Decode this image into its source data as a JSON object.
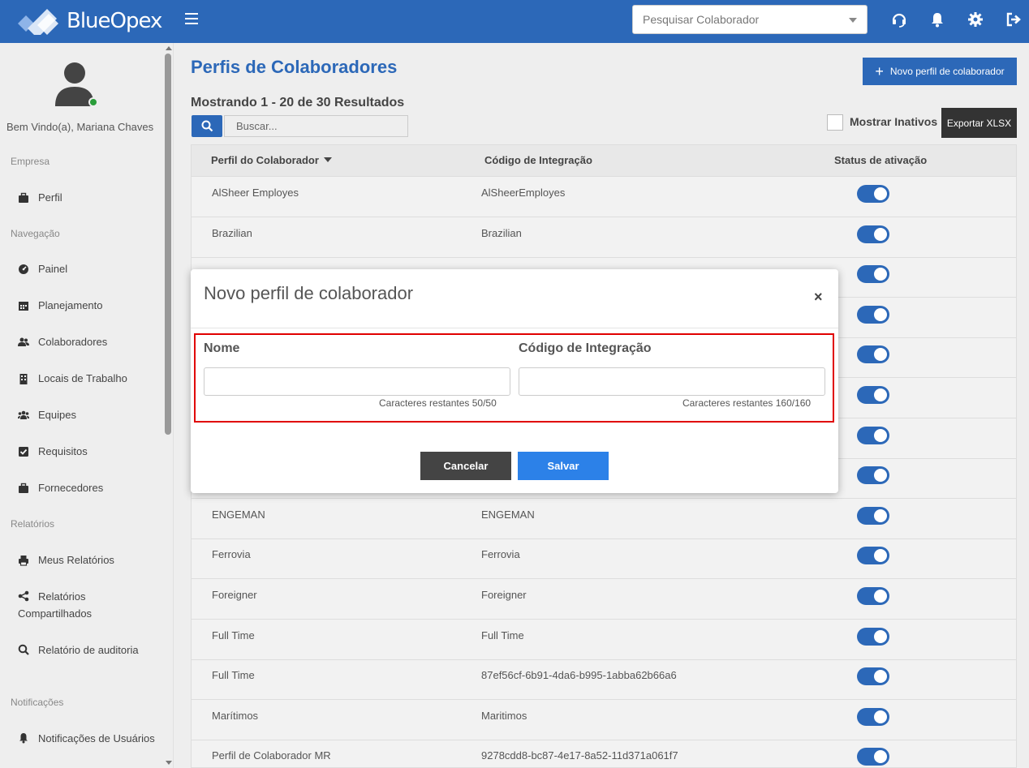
{
  "app": {
    "brand": "BlueOpex"
  },
  "topbar": {
    "search_placeholder": "Pesquisar Colaborador",
    "icons": [
      "headset-icon",
      "bell-icon",
      "gear-icon",
      "logout-icon"
    ]
  },
  "sidebar": {
    "welcome": "Bem Vindo(a), Mariana Chaves",
    "sections": {
      "empresa": "Empresa",
      "navegacao": "Navegação",
      "relatorios": "Relatórios",
      "notificacoes": "Notificações"
    },
    "items": {
      "perfil": "Perfil",
      "painel": "Painel",
      "planejamento": "Planejamento",
      "colaboradores": "Colaboradores",
      "locais": "Locais de Trabalho",
      "equipes": "Equipes",
      "requisitos": "Requisitos",
      "fornecedores": "Fornecedores",
      "meus_relatorios": "Meus Relatórios",
      "relatorios_comp": "Relatórios Compartilhados",
      "auditoria": "Relatório de auditoria",
      "notificacoes_usuarios": "Notificações de Usuários"
    }
  },
  "main": {
    "title": "Perfis de Colaboradores",
    "new_button": "Novo perfil de colaborador",
    "showing": "Mostrando 1 - 20 de 30 Resultados",
    "search_placeholder": "Buscar...",
    "show_inactive": "Mostrar Inativos",
    "export_button": "Exportar XLSX",
    "columns": {
      "profile": "Perfil do Colaborador",
      "code": "Código de Integração",
      "status": "Status de ativação"
    },
    "rows": [
      {
        "name": "AlSheer Employes",
        "code": "AlSheerEmployes",
        "active": true
      },
      {
        "name": "Brazilian",
        "code": "Brazilian",
        "active": true
      },
      {
        "name": "",
        "code": "",
        "active": true
      },
      {
        "name": "",
        "code": "",
        "active": true
      },
      {
        "name": "",
        "code": "",
        "active": true
      },
      {
        "name": "",
        "code": "",
        "active": true
      },
      {
        "name": "",
        "code": "",
        "active": true
      },
      {
        "name": "",
        "code": "",
        "active": true
      },
      {
        "name": "ENGEMAN",
        "code": "ENGEMAN",
        "active": true
      },
      {
        "name": "Ferrovia",
        "code": "Ferrovia",
        "active": true
      },
      {
        "name": "Foreigner",
        "code": "Foreigner",
        "active": true
      },
      {
        "name": "Full Time",
        "code": "Full Time",
        "active": true
      },
      {
        "name": "Full Time",
        "code": "87ef56cf-6b91-4da6-b995-1abba62b66a6",
        "active": true
      },
      {
        "name": "Marítimos",
        "code": "Maritimos",
        "active": true
      },
      {
        "name": "Perfil de Colaborador MR",
        "code": "9278cdd8-bc87-4e17-8a52-11d371a061f7",
        "active": true
      }
    ]
  },
  "modal": {
    "title": "Novo perfil de colaborador",
    "close": "×",
    "name_label": "Nome",
    "code_label": "Código de Integração",
    "name_value": "",
    "code_value": "",
    "name_counter": "Caracteres restantes 50/50",
    "code_counter": "Caracteres restantes 160/160",
    "cancel": "Cancelar",
    "save": "Salvar"
  }
}
